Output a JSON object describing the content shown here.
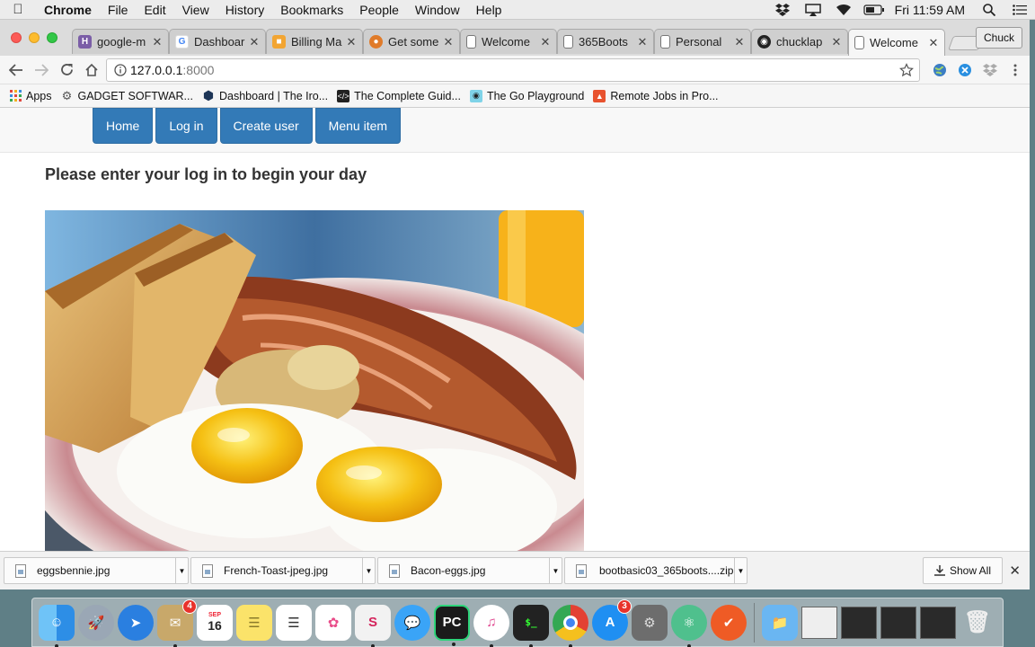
{
  "menubar": {
    "app_name": "Chrome",
    "items": [
      "File",
      "Edit",
      "View",
      "History",
      "Bookmarks",
      "People",
      "Window",
      "Help"
    ],
    "clock": "Fri 11:59 AM"
  },
  "browser": {
    "tabs": [
      {
        "title": "google-m",
        "favicon": "H",
        "favicon_color": "#7b5ea7"
      },
      {
        "title": "Dashboar",
        "favicon": "G",
        "favicon_color": "#4285f4"
      },
      {
        "title": "Billing Ma",
        "favicon": "b",
        "favicon_color": "#f2a533"
      },
      {
        "title": "Get some",
        "favicon": "c",
        "favicon_color": "#e07b2a"
      },
      {
        "title": "Welcome",
        "favicon": "doc",
        "favicon_color": "#888888"
      },
      {
        "title": "365Boots",
        "favicon": "doc",
        "favicon_color": "#888888"
      },
      {
        "title": "Personal",
        "favicon": "doc",
        "favicon_color": "#888888"
      },
      {
        "title": "chucklap",
        "favicon": "gh",
        "favicon_color": "#222222"
      },
      {
        "title": "Welcome",
        "favicon": "doc",
        "favicon_color": "#888888",
        "active": true
      }
    ],
    "profile_name": "Chuck",
    "url_host": "127.0.0.1",
    "url_port": ":8000",
    "bookmarks": [
      {
        "label": "Apps",
        "icon": "apps-grid-icon"
      },
      {
        "label": "GADGET SOFTWAR...",
        "icon": "gear-icon"
      },
      {
        "label": "Dashboard | The Iro...",
        "icon": "hexagon-icon"
      },
      {
        "label": "The Complete Guid...",
        "icon": "code-icon"
      },
      {
        "label": "The Go Playground",
        "icon": "gopher-icon"
      },
      {
        "label": "Remote Jobs in Pro...",
        "icon": "remote-icon"
      }
    ]
  },
  "site": {
    "nav": [
      "Home",
      "Log in",
      "Create user",
      "Menu item"
    ],
    "headline": "Please enter your log in to begin your day"
  },
  "downloads": {
    "items": [
      "eggsbennie.jpg",
      "French-Toast-jpeg.jpg",
      "Bacon-eggs.jpg",
      "bootbasic03_365boots....zip"
    ],
    "show_all": "Show All"
  },
  "dock": {
    "mail_badge": "4",
    "calendar_month": "SEP",
    "calendar_day": "16",
    "appstore_badge": "3"
  },
  "colors": {
    "nav_button": "#337ab7",
    "chrome_tab_active": "#f6f6f6"
  }
}
